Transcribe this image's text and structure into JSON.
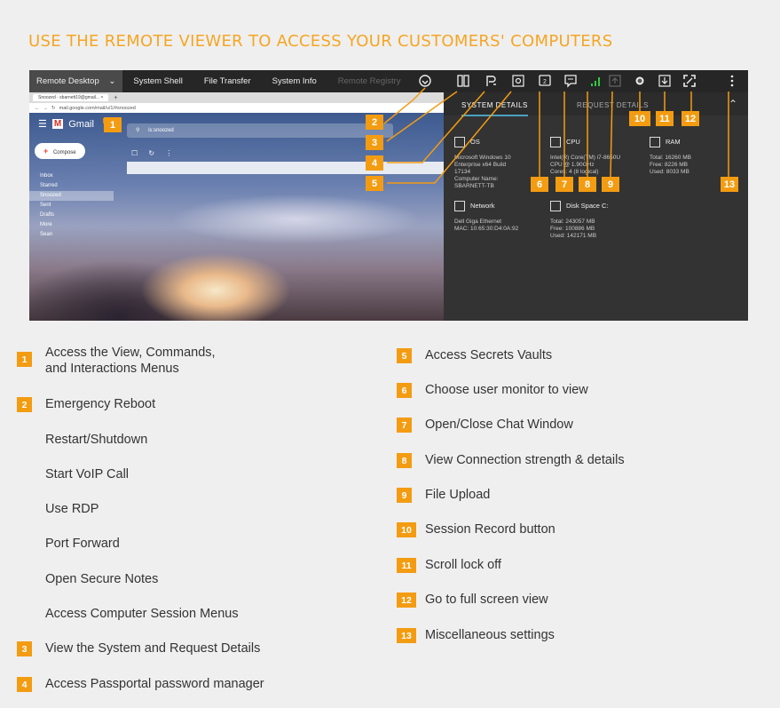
{
  "title": "USE THE REMOTE VIEWER TO ACCESS YOUR CUSTOMERS' COMPUTERS",
  "toolbar": {
    "tabs": [
      "Remote Desktop",
      "System Shell",
      "File Transfer",
      "System Info",
      "Remote Registry"
    ],
    "dropdown_icon": "chevron-down-icon",
    "icons": [
      "power-icon",
      "monitor-select-icon",
      "passportal-icon",
      "vault-icon",
      "display-2-icon",
      "chat-icon",
      "signal-icon",
      "upload-icon",
      "record-icon",
      "scroll-lock-icon",
      "fullscreen-icon",
      "more-icon"
    ],
    "monitor_label": "2"
  },
  "browser": {
    "tab_label": "Snoozed - sbarnett19@gmail... ×",
    "url": "mail.google.com/mail/u/1/#snoozed",
    "gmail": {
      "logo": "Gmail",
      "compose": "Compose",
      "search": "is:snoozed",
      "nav": [
        "Inbox",
        "Starred",
        "Snoozed",
        "Sent",
        "Drafts",
        "More"
      ],
      "user": "Sean"
    }
  },
  "panel": {
    "tabs": [
      "SYSTEM DETAILS",
      "REQUEST DETAILS"
    ],
    "os": {
      "title": "OS",
      "lines": [
        "Microsoft Windows 10",
        "Enterprise x64 Build",
        "17134",
        "Computer Name:",
        "SBARNETT-TB"
      ]
    },
    "cpu": {
      "title": "CPU",
      "lines": [
        "Intel(R) Core(TM) i7-8650U",
        "CPU @ 1.90GHz",
        "Cores: 4 (8 logical)"
      ]
    },
    "ram": {
      "title": "RAM",
      "lines": [
        "Total: 16260 MB",
        "Free: 8226 MB",
        "Used: 8033 MB"
      ]
    },
    "network": {
      "title": "Network",
      "lines": [
        "Dell Giga Ethernet",
        "MAC: 10:65:30:D4:0A:92"
      ]
    },
    "disk": {
      "title": "Disk Space C:",
      "lines": [
        "Total: 243057 MB",
        "Free: 100886 MB",
        "Used: 142171 MB"
      ]
    }
  },
  "badges": [
    "1",
    "2",
    "3",
    "4",
    "5",
    "6",
    "7",
    "8",
    "9",
    "10",
    "11",
    "12",
    "13"
  ],
  "legend_left": [
    {
      "num": "1",
      "text": "Access the View, Commands,",
      "text2": "and Interactions Menus"
    },
    {
      "num": "2",
      "text": "Emergency Reboot"
    },
    {
      "num": "",
      "text": "Restart/Shutdown"
    },
    {
      "num": "",
      "text": "Start VoIP Call"
    },
    {
      "num": "",
      "text": "Use RDP"
    },
    {
      "num": "",
      "text": "Port Forward"
    },
    {
      "num": "",
      "text": "Open Secure Notes"
    },
    {
      "num": "",
      "text": "Access Computer Session Menus"
    },
    {
      "num": "3",
      "text": "View the System and Request Details"
    },
    {
      "num": "4",
      "text": "Access Passportal password manager"
    }
  ],
  "legend_right": [
    {
      "num": "5",
      "text": "Access Secrets Vaults"
    },
    {
      "num": "6",
      "text": "Choose user monitor to view"
    },
    {
      "num": "7",
      "text": "Open/Close Chat Window"
    },
    {
      "num": "8",
      "text": "View Connection strength & details"
    },
    {
      "num": "9",
      "text": "File Upload"
    },
    {
      "num": "10",
      "text": "Session Record button"
    },
    {
      "num": "11",
      "text": "Scroll lock off"
    },
    {
      "num": "12",
      "text": "Go to full screen view"
    },
    {
      "num": "13",
      "text": "Miscellaneous settings"
    }
  ],
  "colors": {
    "accent": "#f39c12",
    "title": "#f5a623",
    "panel": "#333333",
    "topbar": "#262626"
  }
}
